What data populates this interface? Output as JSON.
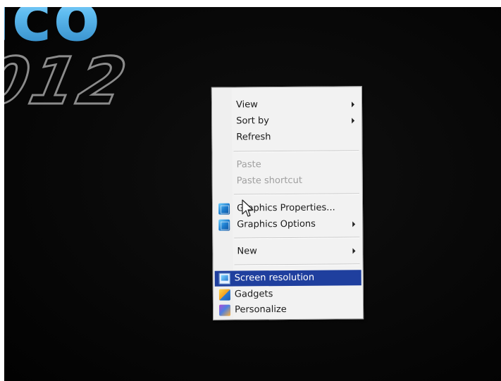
{
  "wallpaper": {
    "logo_text": "ico",
    "year_text": "012"
  },
  "context_menu": {
    "items": [
      {
        "label": "View",
        "has_submenu": true,
        "enabled": true
      },
      {
        "label": "Sort by",
        "has_submenu": true,
        "enabled": true
      },
      {
        "label": "Refresh",
        "has_submenu": false,
        "enabled": true
      },
      {
        "label": "Paste",
        "has_submenu": false,
        "enabled": false
      },
      {
        "label": "Paste shortcut",
        "has_submenu": false,
        "enabled": false
      },
      {
        "label": "Graphics Properties...",
        "has_submenu": false,
        "enabled": true,
        "icon": "graphics-icon"
      },
      {
        "label": "Graphics Options",
        "has_submenu": true,
        "enabled": true,
        "icon": "graphics-icon"
      },
      {
        "label": "New",
        "has_submenu": true,
        "enabled": true
      },
      {
        "label": "Screen resolution",
        "has_submenu": false,
        "enabled": true,
        "icon": "screen-resolution-icon",
        "highlighted": true
      },
      {
        "label": "Gadgets",
        "has_submenu": false,
        "enabled": true,
        "icon": "gadgets-icon"
      },
      {
        "label": "Personalize",
        "has_submenu": false,
        "enabled": true,
        "icon": "personalize-icon"
      }
    ]
  },
  "colors": {
    "highlight": "#1f3f9e",
    "desktop_background": "#080808",
    "logo_blue": "#5fbcf0"
  }
}
